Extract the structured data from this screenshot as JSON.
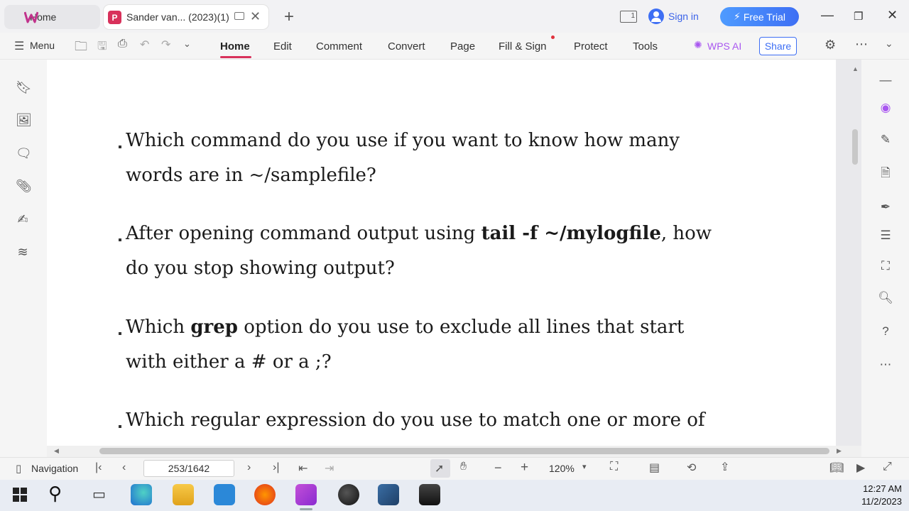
{
  "tabs": [
    {
      "label": "Home"
    },
    {
      "label": "Sander van... (2023)(1)"
    }
  ],
  "account": {
    "sign_in": "Sign in",
    "free_trial": "Free Trial",
    "page_indicator": "1"
  },
  "menu": {
    "menu_label": "Menu",
    "items": [
      "Home",
      "Edit",
      "Comment",
      "Convert",
      "Page",
      "Fill & Sign",
      "Protect",
      "Tools"
    ],
    "active": "Home",
    "wps_ai": "WPS AI",
    "share": "Share"
  },
  "document": {
    "q1_line1": "Which command do you use if you want to know how many",
    "q1_line2": "words are in ~/samplefile?",
    "q2_pre": "After opening command output using ",
    "q2_bold": "tail -f ~/mylogfile",
    "q2_post": ", how",
    "q2_line2": "do you stop showing output?",
    "q3_pre": "Which ",
    "q3_bold": "grep",
    "q3_post": " option do you use to exclude all lines that start",
    "q3_line2": "with either a # or a ;?",
    "q4_line1": "Which regular expression do you use to match one or more of"
  },
  "status": {
    "navigation": "Navigation",
    "page": "253/1642",
    "zoom": "120%"
  },
  "taskbar": {
    "time": "12:27 AM",
    "date": "11/2/2023"
  },
  "colors": {
    "accent": "#d8315b",
    "brand_blue": "#3e6ff4",
    "ai_purple": "#a957f0"
  }
}
